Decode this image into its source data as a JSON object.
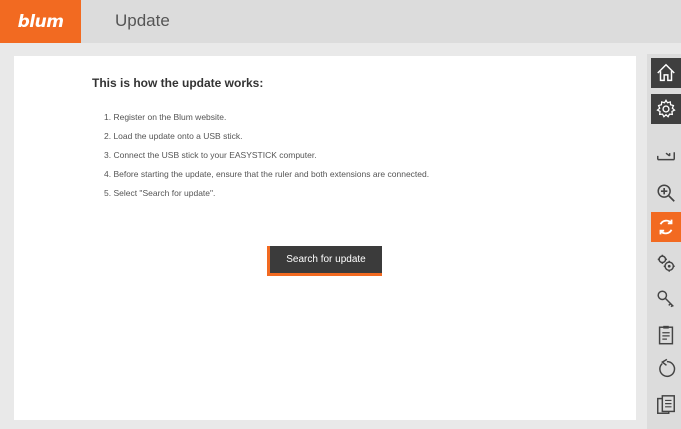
{
  "header": {
    "logo": "blum",
    "title": "Update"
  },
  "main": {
    "heading": "This is how the update works:",
    "steps": [
      "1. Register on the Blum website.",
      "2. Load the update onto a USB stick.",
      "3. Connect the USB stick to your EASYSTICK computer.",
      "4. Before starting the update, ensure that the ruler and both extensions are connected.",
      "5. Select \"Search for update\"."
    ],
    "button_label": "Search for update"
  },
  "sidebar": {
    "items": [
      {
        "icon": "home-icon",
        "state": "dark"
      },
      {
        "icon": "settings-gear-icon",
        "state": "dark"
      },
      {
        "icon": "ruler-icon",
        "state": "normal"
      },
      {
        "icon": "zoom-icon",
        "state": "normal"
      },
      {
        "icon": "update-sync-icon",
        "state": "active"
      },
      {
        "icon": "gears-icon",
        "state": "normal"
      },
      {
        "icon": "key-icon",
        "state": "normal"
      },
      {
        "icon": "checklist-icon",
        "state": "normal"
      },
      {
        "icon": "reset-icon",
        "state": "normal"
      },
      {
        "icon": "documents-icon",
        "state": "normal"
      }
    ]
  },
  "colors": {
    "accent": "#f26a21",
    "dark_button": "#3b3b3b",
    "header_bg": "#dcdcdc"
  }
}
